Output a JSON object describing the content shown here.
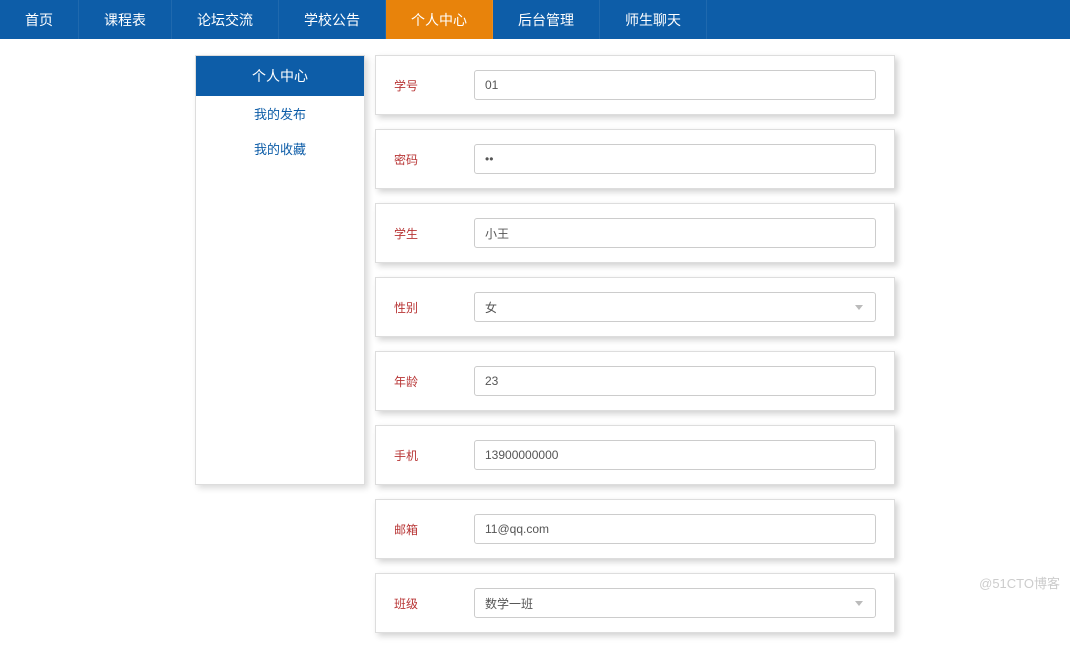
{
  "nav": {
    "items": [
      {
        "label": "首页"
      },
      {
        "label": "课程表"
      },
      {
        "label": "论坛交流"
      },
      {
        "label": "学校公告"
      },
      {
        "label": "个人中心",
        "active": true
      },
      {
        "label": "后台管理"
      },
      {
        "label": "师生聊天"
      }
    ]
  },
  "sidebar": {
    "title": "个人中心",
    "items": [
      {
        "label": "我的发布"
      },
      {
        "label": "我的收藏"
      }
    ]
  },
  "form": {
    "fields": [
      {
        "label": "学号",
        "type": "text",
        "value": "01"
      },
      {
        "label": "密码",
        "type": "password",
        "value": "ab"
      },
      {
        "label": "学生",
        "type": "text",
        "value": "小王"
      },
      {
        "label": "性别",
        "type": "select",
        "value": "女"
      },
      {
        "label": "年龄",
        "type": "text",
        "value": "23"
      },
      {
        "label": "手机",
        "type": "text",
        "value": "13900000000"
      },
      {
        "label": "邮箱",
        "type": "text",
        "value": "11@qq.com"
      },
      {
        "label": "班级",
        "type": "select",
        "value": "数学一班"
      }
    ]
  },
  "watermark": "@51CTO博客"
}
